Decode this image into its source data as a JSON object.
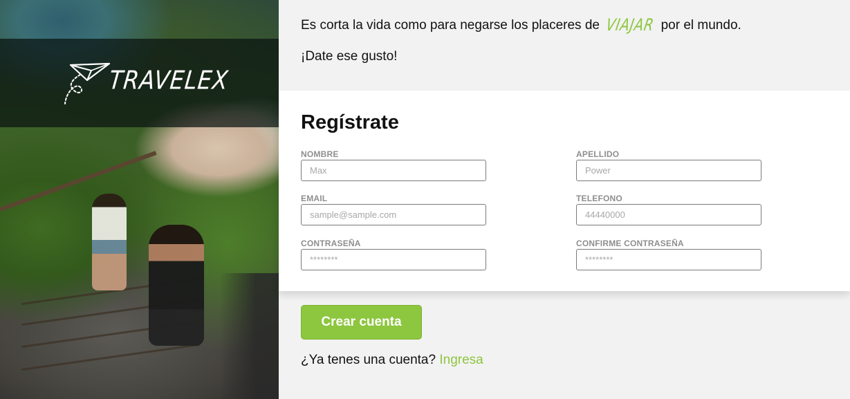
{
  "brand": {
    "name": "TRAVELEX",
    "logo_icon": "paper-plane-icon"
  },
  "intro": {
    "line1_before": "Es corta la vida como para negarse los placeres de",
    "line1_highlight": "VIAJAR",
    "line1_after": "por el mundo.",
    "line2": "¡Date ese gusto!"
  },
  "form": {
    "title": "Regístrate",
    "fields": {
      "nombre": {
        "label": "NOMBRE",
        "placeholder": "Max"
      },
      "apellido": {
        "label": "APELLIDO",
        "placeholder": "Power"
      },
      "email": {
        "label": "EMAIL",
        "placeholder": "sample@sample.com"
      },
      "telefono": {
        "label": "TELEFONO",
        "placeholder": "44440000"
      },
      "password": {
        "label": "CONTRASEÑA",
        "placeholder": "********"
      },
      "password2": {
        "label": "CONFIRME CONTRASEÑA",
        "placeholder": "********"
      }
    },
    "submit_label": "Crear cuenta"
  },
  "login": {
    "prompt": "¿Ya tenes una cuenta?",
    "link_label": "Ingresa"
  },
  "colors": {
    "accent": "#8dc63f",
    "page_bg": "#f2f2f2",
    "card_bg": "#ffffff",
    "label_gray": "#8e8e8e"
  }
}
